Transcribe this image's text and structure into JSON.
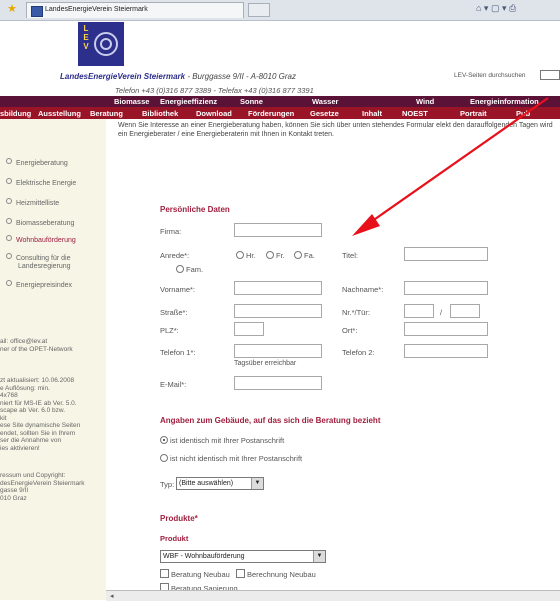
{
  "browser": {
    "tab_title": "LandesEnergieVerein Steiermark",
    "star_icon": "star-icon",
    "toolbar_icons": "⌂ ▾ ▢ ▾ ⎙"
  },
  "header": {
    "logo_letters": "L\nE\nV",
    "org_name": "LandesEnergieVerein Steiermark",
    "org_address": " - Burggasse 9/II - A-8010 Graz",
    "contact": "Telefon +43 (0)316 877 3389 - Telefax +43 (0)316 877 3391",
    "search_label": "LEV-Seiten durchsuchen"
  },
  "nav_top": [
    "Biomasse",
    "Energieeffizienz",
    "Sonne",
    "Wasser",
    "Wind",
    "Energieinformation"
  ],
  "nav_bottom": [
    "sbildung",
    "Ausstellung",
    "Beratung",
    "Bibliothek",
    "Download",
    "Förderungen",
    "Gesetze",
    "Inhalt",
    "NOEST",
    "Portrait",
    "Pub"
  ],
  "sidebar": {
    "items": [
      "Energieberatung",
      "Elektrische Energie",
      "Heizmittelliste",
      "Biomasseberatung",
      "Wohnbauförderung",
      "Consulting für die",
      "Landesregierung",
      "Energiepreisindex"
    ],
    "contact_lines": "ail: office@lev.at\nner of the OPET-Network",
    "info_lines": "zt aktualisiert: 10.06.2008\ne Auflösung: min.\n4x768\nniert für MS-IE ab Ver. 5.0.\nscape ab Ver. 6.0 bzw.\nkit\nese Site dynamische Seiten\nendet, sollten Sie in Ihrem\nser die Annahme von\nies aktivieren!",
    "copyright_lines": "ressum und Copyright:\ndesEnergieVerein Steiermark\ngasse 9/II\n010 Graz"
  },
  "intro": "Wenn Sie Interesse an einer Energieberatung haben, können Sie sich über unten stehendes Formular elekt den darauffolgenden Tagen wird ein Energieberater / eine Energieberaterin mit Ihnen in Kontakt treten.",
  "form": {
    "section_personal": "Persönliche Daten",
    "firma": "Firma:",
    "anrede": "Anrede*:",
    "anrede_options": [
      "Hr.",
      "Fr.",
      "Fa.",
      "Fam."
    ],
    "titel": "Titel:",
    "vorname": "Vorname*:",
    "nachname": "Nachname*:",
    "strasse": "Straße*:",
    "nr_tuer": "Nr.*/Tür:",
    "slash": "/",
    "plz": "PLZ*:",
    "ort": "Ort*:",
    "telefon1": "Telefon 1*:",
    "telefon2": "Telefon 2:",
    "tagsueber": "Tagsüber erreichbar",
    "email": "E-Mail*:",
    "section_building": "Angaben zum Gebäude, auf das sich die Beratung bezieht",
    "ident_yes": "ist identisch mit Ihrer Postanschrift",
    "ident_no": "ist nicht identisch mit Ihrer Postanschrift",
    "typ_label": "Typ:",
    "typ_value": "(Bitte auswählen)",
    "section_products": "Produkte*",
    "produkt_label": "Produkt",
    "produkt_value": "WBF - Wohnbauförderung",
    "checkboxes": [
      "Beratung Neubau",
      "Berechnung Neubau",
      "Beratung Sanierung"
    ]
  },
  "accent_colors": {
    "nav_top": "#5a1236",
    "nav_bottom": "#9a1428",
    "section_title": "#a02040",
    "annotation_arrow": "#e8101a"
  }
}
